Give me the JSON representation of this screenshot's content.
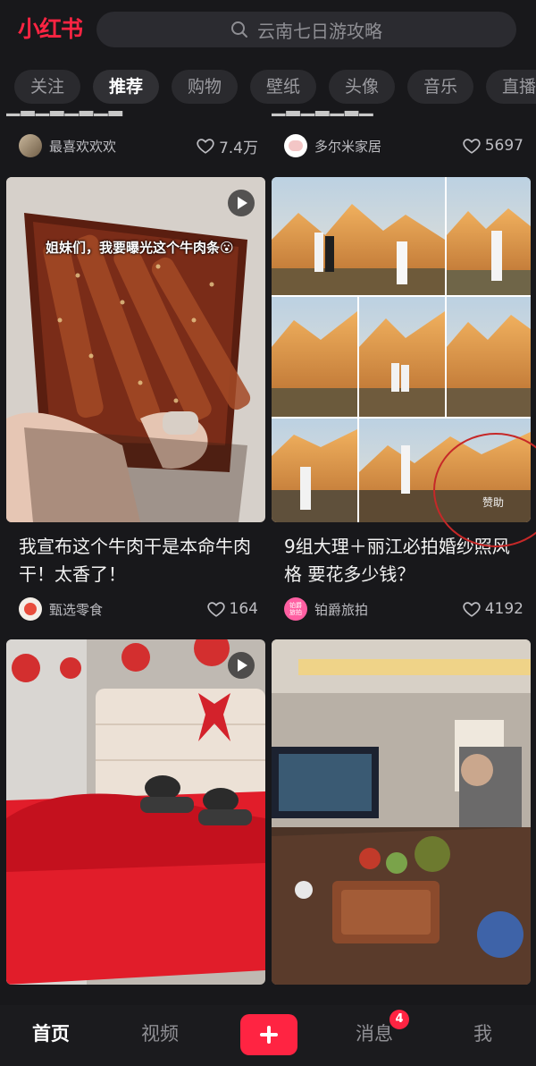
{
  "app": {
    "logo_text": "小红书",
    "brand_color": "#ff2442"
  },
  "search": {
    "placeholder": "云南七日游攻略",
    "icon": "search-icon"
  },
  "tabs": [
    {
      "label": "关注",
      "active": false
    },
    {
      "label": "推荐",
      "active": true
    },
    {
      "label": "购物",
      "active": false
    },
    {
      "label": "壁纸",
      "active": false
    },
    {
      "label": "头像",
      "active": false
    },
    {
      "label": "音乐",
      "active": false
    },
    {
      "label": "直播",
      "active": false
    }
  ],
  "feed": {
    "left": [
      {
        "type": "partial",
        "author": "最喜欢欢欢",
        "likes": "7.4万"
      },
      {
        "type": "video",
        "overlay_text": "姐妹们，我要曝光这个牛肉条😮",
        "title": "我宣布这个牛肉干是本命牛肉干！太香了！",
        "author": "甄选零食",
        "likes": "164"
      },
      {
        "type": "video",
        "title": ""
      }
    ],
    "right": [
      {
        "type": "partial",
        "author": "多尔米家居",
        "likes": "5697"
      },
      {
        "type": "sponsored",
        "sponsor_label": "赞助",
        "title": "9组大理＋丽江必拍婚纱照风格 要花多少钱？",
        "author": "铂爵旅拍",
        "author_avatar_text": "铂爵旅拍",
        "likes": "4192"
      },
      {
        "type": "image",
        "title": ""
      }
    ]
  },
  "bottom_nav": {
    "home": "首页",
    "video": "视频",
    "messages": "消息",
    "messages_badge": "4",
    "me": "我"
  }
}
